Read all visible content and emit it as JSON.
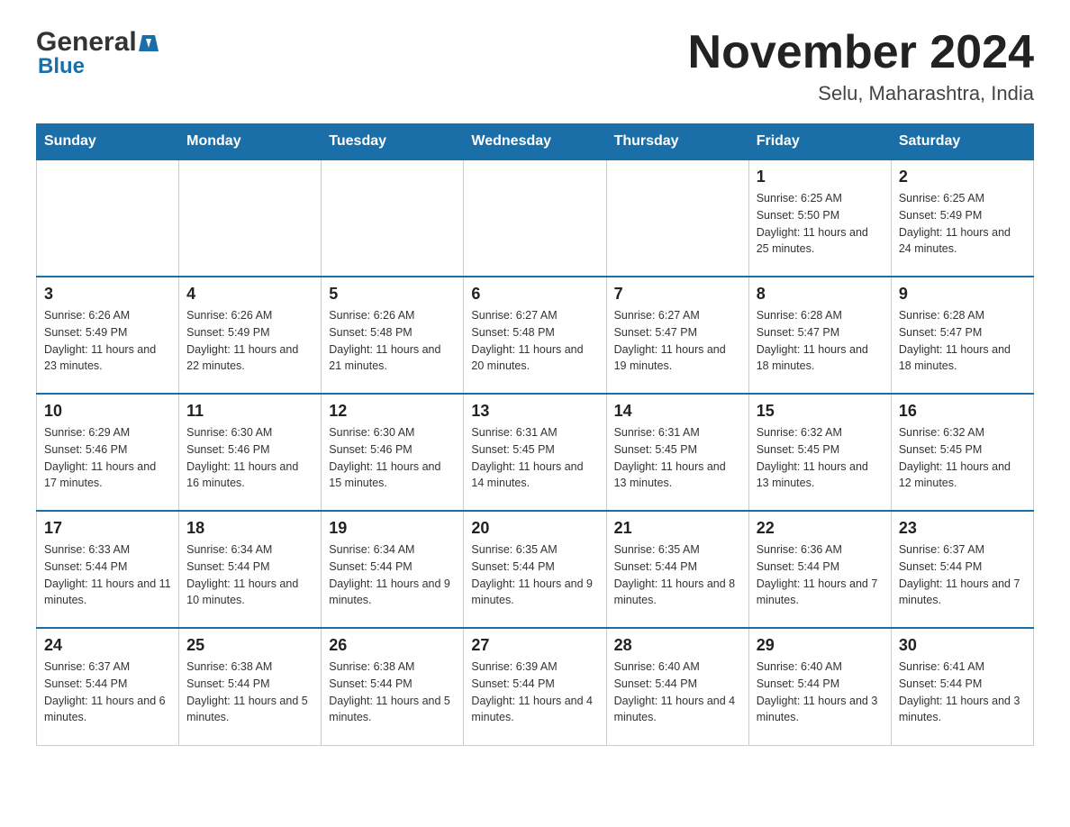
{
  "header": {
    "logo_general": "General",
    "logo_blue": "Blue",
    "month_title": "November 2024",
    "location": "Selu, Maharashtra, India"
  },
  "days_of_week": [
    "Sunday",
    "Monday",
    "Tuesday",
    "Wednesday",
    "Thursday",
    "Friday",
    "Saturday"
  ],
  "weeks": [
    [
      {
        "day": "",
        "info": ""
      },
      {
        "day": "",
        "info": ""
      },
      {
        "day": "",
        "info": ""
      },
      {
        "day": "",
        "info": ""
      },
      {
        "day": "",
        "info": ""
      },
      {
        "day": "1",
        "info": "Sunrise: 6:25 AM\nSunset: 5:50 PM\nDaylight: 11 hours and 25 minutes."
      },
      {
        "day": "2",
        "info": "Sunrise: 6:25 AM\nSunset: 5:49 PM\nDaylight: 11 hours and 24 minutes."
      }
    ],
    [
      {
        "day": "3",
        "info": "Sunrise: 6:26 AM\nSunset: 5:49 PM\nDaylight: 11 hours and 23 minutes."
      },
      {
        "day": "4",
        "info": "Sunrise: 6:26 AM\nSunset: 5:49 PM\nDaylight: 11 hours and 22 minutes."
      },
      {
        "day": "5",
        "info": "Sunrise: 6:26 AM\nSunset: 5:48 PM\nDaylight: 11 hours and 21 minutes."
      },
      {
        "day": "6",
        "info": "Sunrise: 6:27 AM\nSunset: 5:48 PM\nDaylight: 11 hours and 20 minutes."
      },
      {
        "day": "7",
        "info": "Sunrise: 6:27 AM\nSunset: 5:47 PM\nDaylight: 11 hours and 19 minutes."
      },
      {
        "day": "8",
        "info": "Sunrise: 6:28 AM\nSunset: 5:47 PM\nDaylight: 11 hours and 18 minutes."
      },
      {
        "day": "9",
        "info": "Sunrise: 6:28 AM\nSunset: 5:47 PM\nDaylight: 11 hours and 18 minutes."
      }
    ],
    [
      {
        "day": "10",
        "info": "Sunrise: 6:29 AM\nSunset: 5:46 PM\nDaylight: 11 hours and 17 minutes."
      },
      {
        "day": "11",
        "info": "Sunrise: 6:30 AM\nSunset: 5:46 PM\nDaylight: 11 hours and 16 minutes."
      },
      {
        "day": "12",
        "info": "Sunrise: 6:30 AM\nSunset: 5:46 PM\nDaylight: 11 hours and 15 minutes."
      },
      {
        "day": "13",
        "info": "Sunrise: 6:31 AM\nSunset: 5:45 PM\nDaylight: 11 hours and 14 minutes."
      },
      {
        "day": "14",
        "info": "Sunrise: 6:31 AM\nSunset: 5:45 PM\nDaylight: 11 hours and 13 minutes."
      },
      {
        "day": "15",
        "info": "Sunrise: 6:32 AM\nSunset: 5:45 PM\nDaylight: 11 hours and 13 minutes."
      },
      {
        "day": "16",
        "info": "Sunrise: 6:32 AM\nSunset: 5:45 PM\nDaylight: 11 hours and 12 minutes."
      }
    ],
    [
      {
        "day": "17",
        "info": "Sunrise: 6:33 AM\nSunset: 5:44 PM\nDaylight: 11 hours and 11 minutes."
      },
      {
        "day": "18",
        "info": "Sunrise: 6:34 AM\nSunset: 5:44 PM\nDaylight: 11 hours and 10 minutes."
      },
      {
        "day": "19",
        "info": "Sunrise: 6:34 AM\nSunset: 5:44 PM\nDaylight: 11 hours and 9 minutes."
      },
      {
        "day": "20",
        "info": "Sunrise: 6:35 AM\nSunset: 5:44 PM\nDaylight: 11 hours and 9 minutes."
      },
      {
        "day": "21",
        "info": "Sunrise: 6:35 AM\nSunset: 5:44 PM\nDaylight: 11 hours and 8 minutes."
      },
      {
        "day": "22",
        "info": "Sunrise: 6:36 AM\nSunset: 5:44 PM\nDaylight: 11 hours and 7 minutes."
      },
      {
        "day": "23",
        "info": "Sunrise: 6:37 AM\nSunset: 5:44 PM\nDaylight: 11 hours and 7 minutes."
      }
    ],
    [
      {
        "day": "24",
        "info": "Sunrise: 6:37 AM\nSunset: 5:44 PM\nDaylight: 11 hours and 6 minutes."
      },
      {
        "day": "25",
        "info": "Sunrise: 6:38 AM\nSunset: 5:44 PM\nDaylight: 11 hours and 5 minutes."
      },
      {
        "day": "26",
        "info": "Sunrise: 6:38 AM\nSunset: 5:44 PM\nDaylight: 11 hours and 5 minutes."
      },
      {
        "day": "27",
        "info": "Sunrise: 6:39 AM\nSunset: 5:44 PM\nDaylight: 11 hours and 4 minutes."
      },
      {
        "day": "28",
        "info": "Sunrise: 6:40 AM\nSunset: 5:44 PM\nDaylight: 11 hours and 4 minutes."
      },
      {
        "day": "29",
        "info": "Sunrise: 6:40 AM\nSunset: 5:44 PM\nDaylight: 11 hours and 3 minutes."
      },
      {
        "day": "30",
        "info": "Sunrise: 6:41 AM\nSunset: 5:44 PM\nDaylight: 11 hours and 3 minutes."
      }
    ]
  ]
}
